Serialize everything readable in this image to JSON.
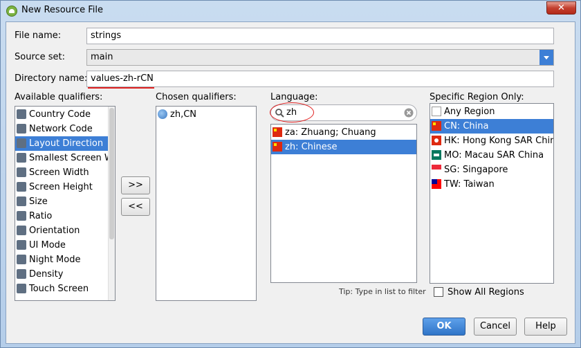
{
  "window": {
    "title": "New Resource File",
    "close_label": "✕"
  },
  "form": {
    "file_name_label": "File name:",
    "file_name_value": "strings",
    "source_set_label": "Source set:",
    "source_set_value": "main",
    "directory_label": "Directory name:",
    "directory_value": "values-zh-rCN"
  },
  "available_qualifiers": {
    "label": "Available qualifiers:",
    "items": [
      {
        "label": "Country Code",
        "icon": "country-code-icon"
      },
      {
        "label": "Network Code",
        "icon": "network-code-icon"
      },
      {
        "label": "Layout Direction",
        "icon": "layout-direction-icon",
        "selected": true
      },
      {
        "label": "Smallest Screen Wi",
        "icon": "smallest-screen-icon"
      },
      {
        "label": "Screen Width",
        "icon": "screen-width-icon"
      },
      {
        "label": "Screen Height",
        "icon": "screen-height-icon"
      },
      {
        "label": "Size",
        "icon": "size-icon"
      },
      {
        "label": "Ratio",
        "icon": "ratio-icon"
      },
      {
        "label": "Orientation",
        "icon": "orientation-icon"
      },
      {
        "label": "UI Mode",
        "icon": "ui-mode-icon"
      },
      {
        "label": "Night Mode",
        "icon": "night-mode-icon"
      },
      {
        "label": "Density",
        "icon": "density-icon"
      },
      {
        "label": "Touch Screen",
        "icon": "touch-screen-icon"
      }
    ]
  },
  "buttons": {
    "add_label": ">>",
    "remove_label": "<<",
    "ok_label": "OK",
    "cancel_label": "Cancel",
    "help_label": "Help"
  },
  "chosen_qualifiers": {
    "label": "Chosen qualifiers:",
    "items": [
      {
        "label": "zh,CN",
        "icon": "globe-icon"
      }
    ]
  },
  "language": {
    "label": "Language:",
    "search_value": "zh",
    "items": [
      {
        "label": "za: Zhuang; Chuang",
        "icon": "flag-cn-icon"
      },
      {
        "label": "zh: Chinese",
        "icon": "flag-cn-icon",
        "selected": true
      }
    ],
    "tip": "Tip: Type in list to filter"
  },
  "region": {
    "label": "Specific Region Only:",
    "items": [
      {
        "label": "Any Region",
        "icon": "blank-flag-icon"
      },
      {
        "label": "CN: China",
        "icon": "flag-cn-icon",
        "selected": true
      },
      {
        "label": "HK: Hong Kong SAR China",
        "icon": "flag-hk-icon"
      },
      {
        "label": "MO: Macau SAR China",
        "icon": "flag-mo-icon"
      },
      {
        "label": "SG: Singapore",
        "icon": "flag-sg-icon"
      },
      {
        "label": "TW: Taiwan",
        "icon": "flag-tw-icon"
      }
    ],
    "show_all_label": "Show All Regions"
  },
  "colors": {
    "selection": "#3d7fd6",
    "annotation": "#e02020"
  }
}
